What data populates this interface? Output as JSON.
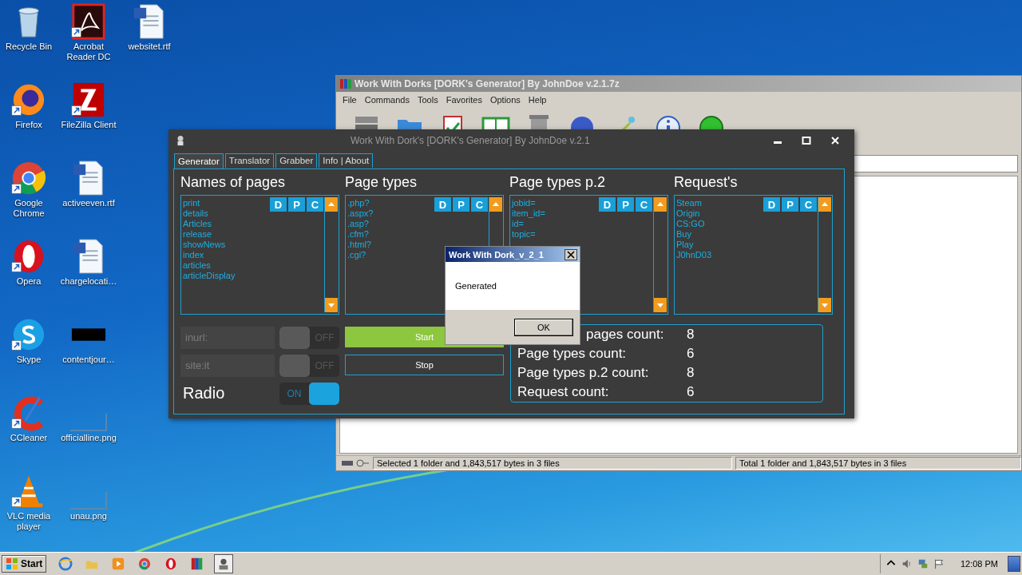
{
  "desktop_icons": [
    {
      "label": "Recycle Bin",
      "kind": "recycle",
      "shortcut": false
    },
    {
      "label": "Firefox",
      "kind": "firefox",
      "shortcut": true
    },
    {
      "label": "Google Chrome",
      "kind": "chrome",
      "shortcut": true
    },
    {
      "label": "Opera",
      "kind": "opera",
      "shortcut": true
    },
    {
      "label": "Skype",
      "kind": "skype",
      "shortcut": true
    },
    {
      "label": "CCleaner",
      "kind": "ccleaner",
      "shortcut": true
    },
    {
      "label": "VLC media player",
      "kind": "vlc",
      "shortcut": true
    },
    {
      "label": "Acrobat Reader DC",
      "kind": "pdf",
      "shortcut": true
    },
    {
      "label": "FileZilla Client",
      "kind": "filezilla",
      "shortcut": true
    },
    {
      "label": "activeeven.rtf",
      "kind": "word",
      "shortcut": false
    },
    {
      "label": "chargelocati…",
      "kind": "word",
      "shortcut": false
    },
    {
      "label": "contentjour…",
      "kind": "black",
      "shortcut": false
    },
    {
      "label": "officialline.png",
      "kind": "blank",
      "shortcut": false
    },
    {
      "label": "unau.png",
      "kind": "blank",
      "shortcut": false
    },
    {
      "label": "websitet.rtf",
      "kind": "word",
      "shortcut": false
    }
  ],
  "background_window": {
    "title": "Work With Dorks [DORK's Generator] By JohnDoe v.2.1.7z",
    "menu": [
      "File",
      "Commands",
      "Tools",
      "Favorites",
      "Options",
      "Help"
    ],
    "toolbar": [
      {
        "kind": "stack"
      },
      {
        "kind": "folder"
      },
      {
        "kind": "clipboard"
      },
      {
        "kind": "book"
      },
      {
        "kind": "trash"
      },
      {
        "kind": "globe"
      },
      {
        "kind": "wand"
      },
      {
        "kind": "info"
      },
      {
        "kind": "virus"
      }
    ],
    "status_bar": [
      "Selected 1 folder and 1,843,517 bytes in 3 files",
      "Total 1 folder and 1,843,517 bytes in 3 files"
    ]
  },
  "dialog": {
    "title": "Work With Dork's [DORK's Generator] By JohnDoe v.2.1",
    "tabs": [
      {
        "label": "Generator",
        "selected": true
      },
      {
        "label": "Translator",
        "selected": false
      },
      {
        "label": "Grabber",
        "selected": false
      },
      {
        "label": "Info | About",
        "selected": false
      }
    ],
    "lists": [
      {
        "heading": "Names of pages",
        "items": [
          "print",
          "details",
          "Articles",
          "release",
          "showNews",
          "index",
          "articles",
          "articleDisplay"
        ],
        "buttons": [
          "D",
          "P",
          "C"
        ]
      },
      {
        "heading": "Page types",
        "items": [
          ".php?",
          ".aspx?",
          ".asp?",
          ".cfm?",
          ".html?",
          ".cgi?"
        ],
        "buttons": [
          "D",
          "P",
          "C"
        ]
      },
      {
        "heading": "Page types p.2",
        "items": [
          "jobid=",
          "item_id=",
          "id=",
          "topic="
        ],
        "buttons": [
          "D",
          "P",
          "C"
        ]
      },
      {
        "heading": "Request's",
        "items": [
          "Steam",
          "Origin",
          "CS:GO",
          "Buy",
          "Play",
          "J0hnD03"
        ],
        "buttons": [
          "D",
          "P",
          "C"
        ]
      }
    ],
    "filters": [
      {
        "placeholder": "inurl:",
        "toggle": "OFF",
        "on": false
      },
      {
        "placeholder": "site:it",
        "toggle": "OFF",
        "on": false
      }
    ],
    "radio": {
      "label": "Radio",
      "toggle": "ON",
      "on": true
    },
    "actions": [
      {
        "label": "Start",
        "kind": "primary"
      },
      {
        "label": "Stop",
        "kind": "outline"
      }
    ],
    "counts": [
      {
        "label": "pages count:",
        "value": "8"
      },
      {
        "label": "Page types count:",
        "value": "6"
      },
      {
        "label": "Page types p.2 count:",
        "value": "8"
      },
      {
        "label": "Request count:",
        "value": "6"
      }
    ]
  },
  "message_box": {
    "title": "Work With Dork_v_2_1",
    "text": "Generated",
    "button": "OK"
  },
  "taskbar": {
    "start": "Start",
    "apps": [
      {
        "kind": "ie",
        "active": false
      },
      {
        "kind": "explorer",
        "active": false
      },
      {
        "kind": "media",
        "active": false
      },
      {
        "kind": "chrome",
        "active": false
      },
      {
        "kind": "opera",
        "active": false
      },
      {
        "kind": "winrar",
        "active": false
      },
      {
        "kind": "app",
        "active": true
      }
    ],
    "clock": "12:08 PM"
  }
}
